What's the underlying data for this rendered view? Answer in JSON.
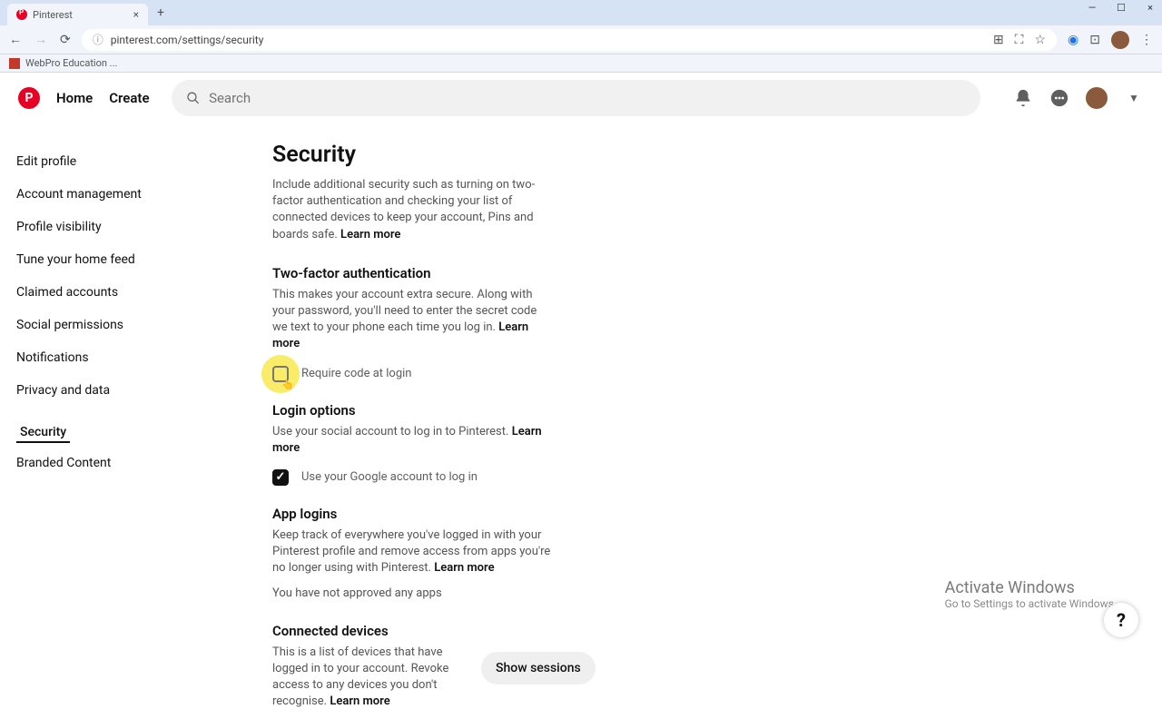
{
  "browser": {
    "tab_title": "Pinterest",
    "url": "pinterest.com/settings/security",
    "bookmark": "WebPro Education ..."
  },
  "header": {
    "home": "Home",
    "create": "Create",
    "search_placeholder": "Search"
  },
  "sidebar": {
    "items": [
      "Edit profile",
      "Account management",
      "Profile visibility",
      "Tune your home feed",
      "Claimed accounts",
      "Social permissions",
      "Notifications",
      "Privacy and data",
      "Security",
      "Branded Content"
    ]
  },
  "content": {
    "title": "Security",
    "intro": "Include additional security such as turning on two-factor authentication and checking your list of connected devices to keep your account, Pins and boards safe.",
    "learn_more": "Learn more",
    "tfa": {
      "title": "Two-factor authentication",
      "desc": "This makes your account extra secure. Along with your password, you'll need to enter the secret code we text to your phone each time you log in.",
      "checkbox": "Require code at login"
    },
    "login": {
      "title": "Login options",
      "desc": "Use your social account to log in to Pinterest.",
      "google": "Use your Google account to log in"
    },
    "apps": {
      "title": "App logins",
      "desc": "Keep track of everywhere you've logged in with your Pinterest profile and remove access from apps you're no longer using with Pinterest.",
      "status": "You have not approved any apps"
    },
    "devices": {
      "title": "Connected devices",
      "desc": "This is a list of devices that have logged in to your account. Revoke access to any devices you don't recognise.",
      "button": "Show sessions"
    }
  },
  "activate": {
    "title": "Activate Windows",
    "sub": "Go to Settings to activate Windows."
  }
}
